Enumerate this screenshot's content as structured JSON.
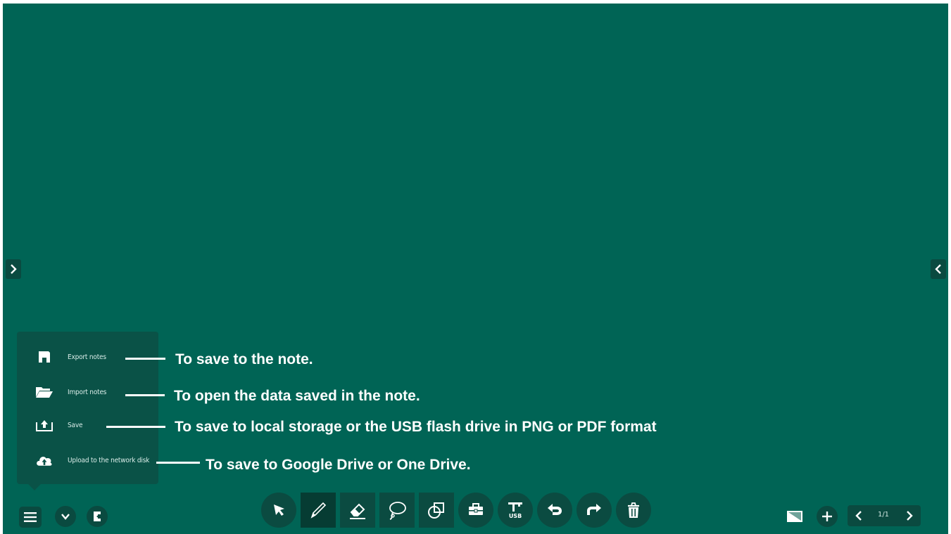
{
  "menu": {
    "items": [
      {
        "label": "Export notes",
        "icon": "floppy-disk-icon"
      },
      {
        "label": "Import notes",
        "icon": "folder-open-icon"
      },
      {
        "label": "Save",
        "icon": "upload-tray-icon"
      },
      {
        "label": "Upload to the network disk",
        "icon": "cloud-upload-icon"
      }
    ]
  },
  "annotations": [
    "To save to the note.",
    "To open the data saved in the note.",
    "To save to local storage or the USB flash drive in PNG or PDF format",
    "To save to Google Drive or One Drive."
  ],
  "toolbar": {
    "tools": [
      {
        "name": "select",
        "icon": "cursor-arrow-icon"
      },
      {
        "name": "pen",
        "icon": "pen-icon",
        "active": true
      },
      {
        "name": "eraser",
        "icon": "eraser-icon"
      },
      {
        "name": "lasso",
        "icon": "lasso-icon"
      },
      {
        "name": "shapes",
        "icon": "shapes-icon"
      },
      {
        "name": "toolbox",
        "icon": "toolbox-icon"
      },
      {
        "name": "usb",
        "icon": "usb-icon",
        "label": "USB"
      },
      {
        "name": "undo",
        "icon": "undo-icon"
      },
      {
        "name": "redo",
        "icon": "redo-icon"
      },
      {
        "name": "delete",
        "icon": "trash-icon"
      }
    ]
  },
  "pager": {
    "page": "1/1"
  },
  "colors": {
    "board": "#006455",
    "panel": "#0a5247",
    "button": "#0a4a40",
    "text": "#ffffff"
  }
}
